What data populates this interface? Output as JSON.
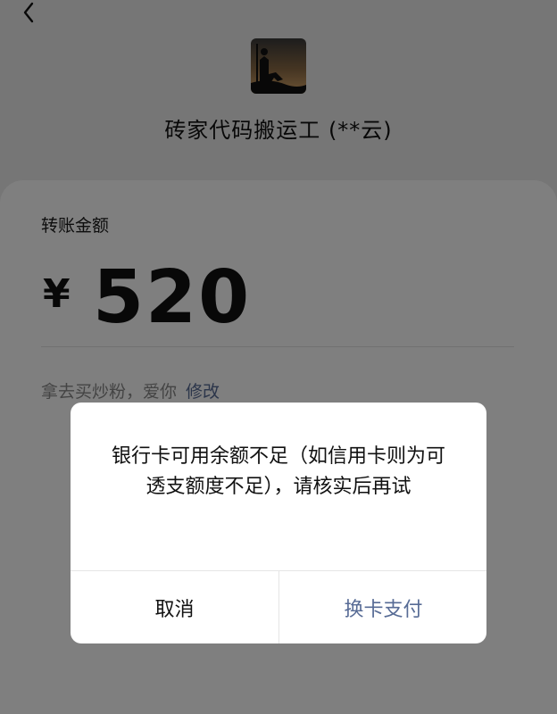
{
  "payee": {
    "name": "砖家代码搬运工 (**云)"
  },
  "transfer": {
    "amount_label": "转账金额",
    "currency_symbol": "¥",
    "amount": "520",
    "note": "拿去买炒粉，爱你",
    "edit_label": "修改"
  },
  "dialog": {
    "message": "银行卡可用余额不足（如信用卡则为可透支额度不足），请核实后再试",
    "cancel_label": "取消",
    "switch_card_label": "换卡支付"
  },
  "colors": {
    "link": "#576b95",
    "overlay": "rgba(0,0,0,0.5)"
  },
  "icons": [
    "back-icon",
    "avatar"
  ]
}
